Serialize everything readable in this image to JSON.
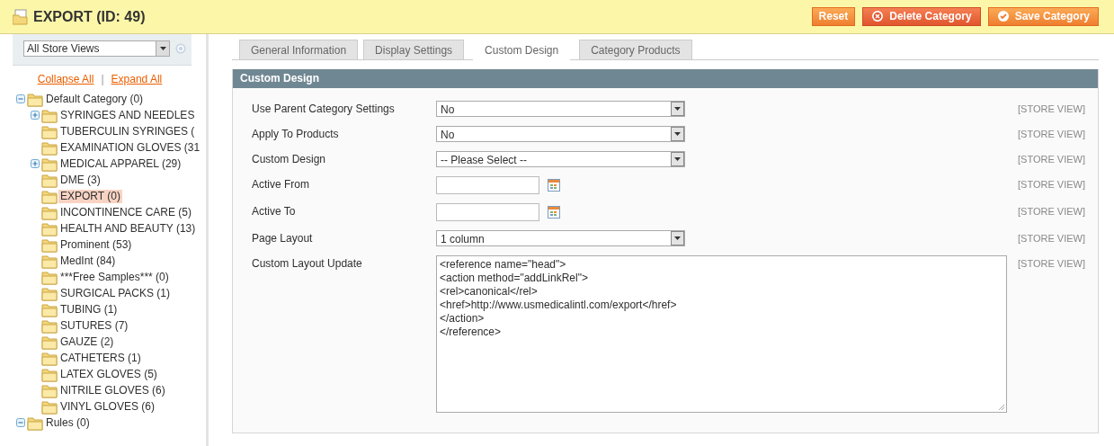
{
  "header": {
    "title": "EXPORT (ID: 49)",
    "buttons": [
      {
        "label": "Reset",
        "kind": "plain"
      },
      {
        "label": "Delete Category",
        "kind": "delete"
      },
      {
        "label": "Save Category",
        "kind": "save"
      }
    ]
  },
  "sidebar": {
    "store_switcher": {
      "value": "All Store Views"
    },
    "links": [
      "Collapse All",
      "|",
      "Expand All"
    ],
    "tree": [
      {
        "label": "Default Category (0)",
        "kind": "branch",
        "expanded": true,
        "selected": false,
        "children": [
          {
            "label": "SYRINGES AND NEEDLES",
            "kind": "branch",
            "expanded": false,
            "selected": false
          },
          {
            "label": "TUBERCULIN SYRINGES (",
            "kind": "leaf",
            "selected": false
          },
          {
            "label": "EXAMINATION GLOVES (31",
            "kind": "leaf",
            "selected": false
          },
          {
            "label": "MEDICAL APPAREL (29)",
            "kind": "branch",
            "expanded": false,
            "selected": false
          },
          {
            "label": "DME (3)",
            "kind": "leaf",
            "selected": false
          },
          {
            "label": "EXPORT (0)",
            "kind": "leaf",
            "selected": true
          },
          {
            "label": "INCONTINENCE CARE (5)",
            "kind": "leaf",
            "selected": false
          },
          {
            "label": "HEALTH AND BEAUTY (13)",
            "kind": "leaf",
            "selected": false
          },
          {
            "label": "Prominent (53)",
            "kind": "leaf",
            "selected": false
          },
          {
            "label": "MedInt (84)",
            "kind": "leaf",
            "selected": false
          },
          {
            "label": "***Free Samples*** (0)",
            "kind": "leaf",
            "selected": false
          },
          {
            "label": "SURGICAL PACKS (1)",
            "kind": "leaf",
            "selected": false
          },
          {
            "label": "TUBING (1)",
            "kind": "leaf",
            "selected": false
          },
          {
            "label": "SUTURES (7)",
            "kind": "leaf",
            "selected": false
          },
          {
            "label": "GAUZE (2)",
            "kind": "leaf",
            "selected": false
          },
          {
            "label": "CATHETERS (1)",
            "kind": "leaf",
            "selected": false
          },
          {
            "label": "LATEX GLOVES (5)",
            "kind": "leaf",
            "selected": false
          },
          {
            "label": "NITRILE GLOVES (6)",
            "kind": "leaf",
            "selected": false
          },
          {
            "label": "VINYL GLOVES (6)",
            "kind": "leaf",
            "selected": false
          }
        ]
      },
      {
        "label": "Rules (0)",
        "kind": "branch",
        "expanded": true,
        "selected": false
      }
    ]
  },
  "tabs": [
    {
      "label": "General Information",
      "selected": false
    },
    {
      "label": "Display Settings",
      "selected": false
    },
    {
      "label": "Custom Design",
      "selected": true
    },
    {
      "label": "Category Products",
      "selected": false
    }
  ],
  "section": {
    "title": "Custom Design",
    "fields": [
      {
        "label": "Use Parent Category Settings",
        "kind": "select",
        "value": "No",
        "scope": "[STORE VIEW]"
      },
      {
        "label": "Apply To Products",
        "kind": "select",
        "value": "No",
        "scope": "[STORE VIEW]"
      },
      {
        "label": "Custom Design",
        "kind": "select",
        "value": "-- Please Select --",
        "scope": "[STORE VIEW]"
      },
      {
        "label": "Active From",
        "kind": "date",
        "scope": "[STORE VIEW]"
      },
      {
        "label": "Active To",
        "kind": "date",
        "scope": "[STORE VIEW]"
      },
      {
        "label": "Page Layout",
        "kind": "select",
        "value": "1 column",
        "scope": "[STORE VIEW]"
      },
      {
        "label": "Custom Layout Update",
        "kind": "textarea",
        "lines": [
          "<reference name=\"head\">",
          "<action method=\"addLinkRel\">",
          "<rel>canonical</rel>",
          "<href>http://www.usmedicalintl.com/export</href>",
          "</action>",
          "</reference>"
        ],
        "scope": "[STORE VIEW]"
      }
    ]
  }
}
